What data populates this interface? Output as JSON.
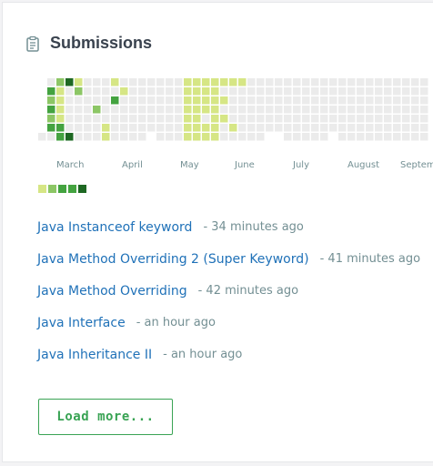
{
  "section": {
    "title": "Submissions",
    "icon": "clipboard-icon"
  },
  "heatmap": {
    "months": [
      "March",
      "April",
      "May",
      "June",
      "July",
      "August",
      "Septem"
    ],
    "colors": {
      "empty": "#ebebeb",
      "level1": "#d6e685",
      "level2": "#8cc665",
      "level3": "#44a340",
      "level4": "#1e6823"
    },
    "legend_levels": [
      1,
      2,
      3,
      3,
      4
    ]
  },
  "submissions": [
    {
      "title": "Java Instanceof keyword",
      "time": "34 minutes ago"
    },
    {
      "title": "Java Method Overriding 2 (Super Keyword)",
      "time": "41 minutes ago"
    },
    {
      "title": "Java Method Overriding",
      "time": "42 minutes ago"
    },
    {
      "title": "Java Interface",
      "time": "an hour ago"
    },
    {
      "title": "Java Inheritance II",
      "time": "an hour ago"
    }
  ],
  "load_more_label": "Load more..."
}
